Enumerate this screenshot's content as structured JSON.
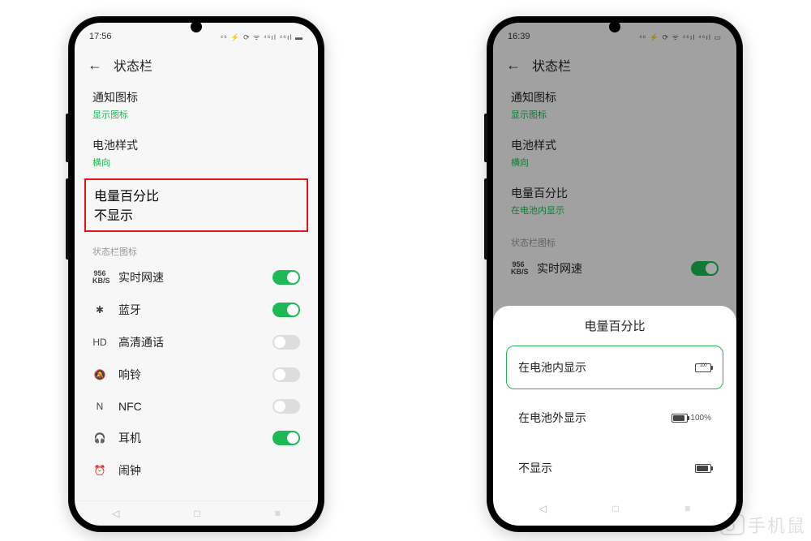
{
  "watermark": "手机鼠",
  "phone1": {
    "time": "17:56",
    "status_right": "⁴⁶ ⚡ ⟳ ᯤ ⁴⁶ıl ⁴⁶ıl ▬",
    "header_title": "状态栏",
    "items": [
      {
        "label": "通知图标",
        "value": "显示图标"
      },
      {
        "label": "电池样式",
        "value": "横向"
      },
      {
        "label": "电量百分比",
        "value": "不显示"
      }
    ],
    "section": "状态栏图标",
    "toggles": [
      {
        "icon": "956\nKB/S",
        "label": "实时网速",
        "on": true,
        "iname": "netspeed-icon"
      },
      {
        "icon": "✱",
        "label": "蓝牙",
        "on": true,
        "iname": "bluetooth-icon"
      },
      {
        "icon": "HD",
        "label": "高清通话",
        "on": false,
        "iname": "hd-icon"
      },
      {
        "icon": "🔕",
        "label": "响铃",
        "on": false,
        "iname": "ring-icon"
      },
      {
        "icon": "N",
        "label": "NFC",
        "on": false,
        "iname": "nfc-icon"
      },
      {
        "icon": "🎧",
        "label": "耳机",
        "on": true,
        "iname": "headphone-icon"
      },
      {
        "icon": "⏰",
        "label": "闹钟",
        "on": null,
        "iname": "alarm-icon"
      }
    ]
  },
  "phone2": {
    "time": "16:39",
    "status_right": "⁴⁶ ⚡ ⟳ ᯤ ⁴⁶ıl ⁴⁶ıl ▭",
    "header_title": "状态栏",
    "items": [
      {
        "label": "通知图标",
        "value": "显示图标"
      },
      {
        "label": "电池样式",
        "value": "横向"
      },
      {
        "label": "电量百分比",
        "value": "在电池内显示"
      }
    ],
    "section": "状态栏图标",
    "toggles": [
      {
        "icon": "956\nKB/S",
        "label": "实时网速",
        "on": true,
        "iname": "netspeed-icon"
      }
    ],
    "sheet": {
      "title": "电量百分比",
      "options": [
        {
          "label": "在电池内显示",
          "selected": true,
          "icon": "inside"
        },
        {
          "label": "在电池外显示",
          "selected": false,
          "icon": "outside",
          "extra": "100%"
        },
        {
          "label": "不显示",
          "selected": false,
          "icon": "plain"
        }
      ]
    }
  }
}
